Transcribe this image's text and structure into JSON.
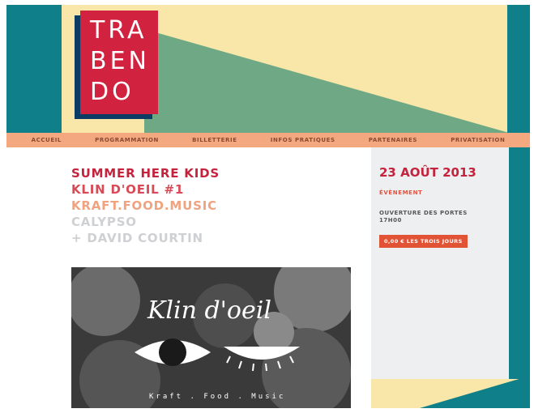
{
  "logo": {
    "line1": "TRA",
    "line2": "BEN",
    "line3": "DO"
  },
  "nav": [
    "ACCUEIL",
    "PROGRAMMATION",
    "BILLETTERIE",
    "INFOS PRATIQUES",
    "PARTENAIRES",
    "PRIVATISATION"
  ],
  "event": {
    "title_lines": [
      "SUMMER HERE KIDS",
      "KLIN D'OEIL #1",
      "KRAFT.FOOD.MUSIC",
      "CALYPSO",
      "+ DAVID COURTIN"
    ],
    "poster_title": "Klin d'oeil",
    "poster_tagline": "Kraft . Food . Music"
  },
  "sidebar": {
    "date": "23 AOÛT 2013",
    "category": "ÉVÈNEMENT",
    "opening_line1": "OUVERTURE DES PORTES",
    "opening_line2": "17H00",
    "price": "0,00 € LES TROIS JOURS"
  },
  "colors": {
    "teal": "#0f7f8a",
    "cream": "#f8e7a8",
    "green": "#6fa884",
    "red": "#d1233f",
    "navy": "#0b3c64",
    "salmon": "#f4a87f",
    "orange": "#e25235"
  }
}
